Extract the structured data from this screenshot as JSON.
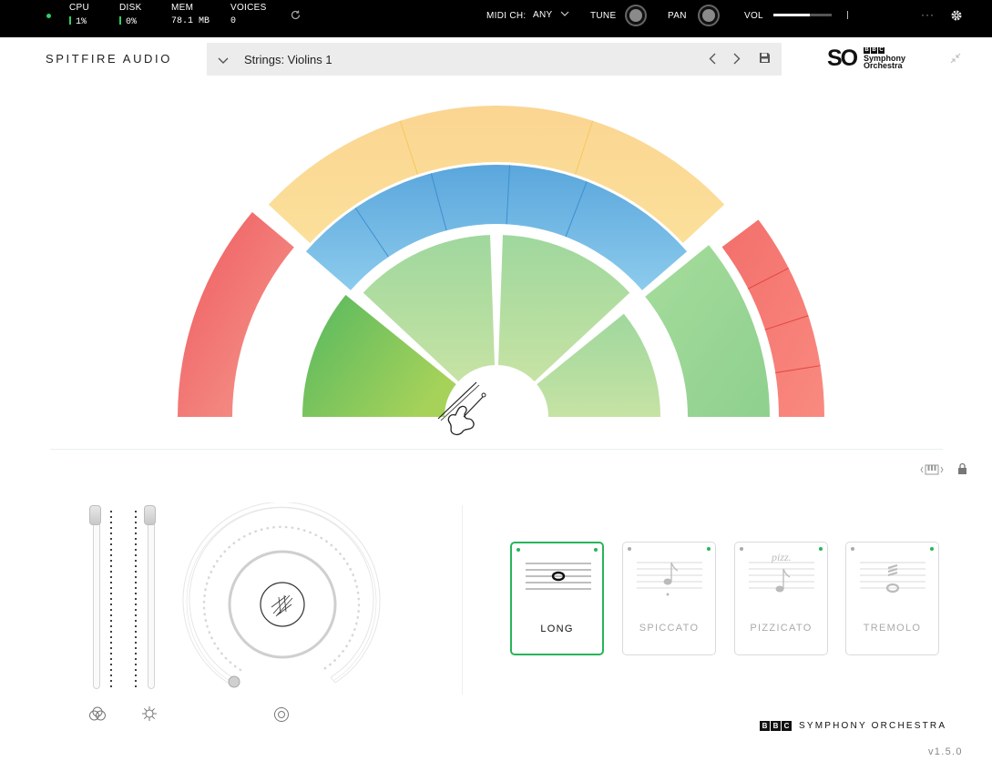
{
  "topbar": {
    "cpu_label": "CPU",
    "cpu_value": "1%",
    "disk_label": "DISK",
    "disk_value": "0%",
    "mem_label": "MEM",
    "mem_value": "78.1 MB",
    "voices_label": "VOICES",
    "voices_value": "0",
    "midi_label": "MIDI CH:",
    "midi_value": "ANY",
    "tune_label": "TUNE",
    "pan_label": "PAN",
    "vol_label": "VOL",
    "vol_level": 0.62,
    "more_label": "···"
  },
  "header": {
    "brand": "SPITFIRE AUDIO",
    "preset_name": "Strings: Violins 1",
    "logo_so": "SO",
    "logo_bbc": [
      "B",
      "B",
      "C"
    ],
    "logo_line1": "Symphony",
    "logo_line2": "Orchestra"
  },
  "stage": {
    "sections": [
      "outer-left-red",
      "outer-top-yellow",
      "middle-blue",
      "inner-left-green",
      "inner-mid-left-green",
      "inner-mid-right-green",
      "inner-right-green",
      "outer-right-green",
      "outer-right-red"
    ],
    "instrument_icon": "violin-icon",
    "colors": {
      "red": "#f26a68",
      "yellow": "#fbd58c",
      "blue": "#74b8e4",
      "green_dark": "#5ebd62",
      "green_light": "#a9dba2"
    }
  },
  "articulations": [
    {
      "label": "LONG",
      "active": true
    },
    {
      "label": "SPICCATO",
      "active": false
    },
    {
      "label": "PIZZICATO",
      "active": false,
      "marking": "pizz."
    },
    {
      "label": "TREMOLO",
      "active": false
    }
  ],
  "footer": {
    "bbc_boxes": [
      "B",
      "B",
      "C"
    ],
    "orchestra_text": "SYMPHONY ORCHESTRA",
    "version": "v1.5.0"
  }
}
